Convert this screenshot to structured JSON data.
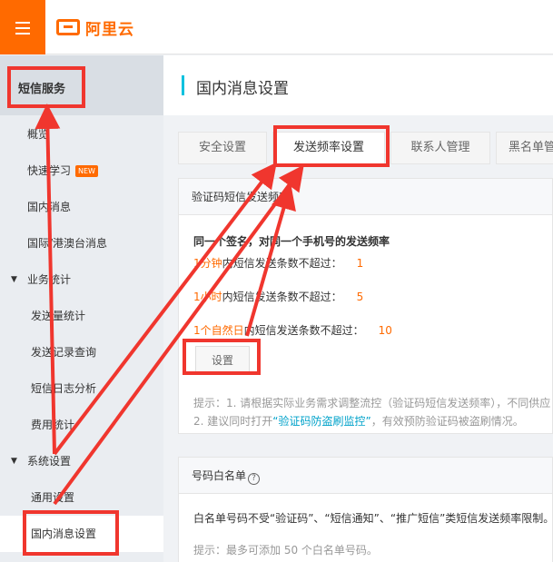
{
  "brand": {
    "name": "阿里云"
  },
  "sidebar": {
    "header": "短信服务",
    "items": [
      {
        "label": "概览"
      },
      {
        "label": "快速学习",
        "badge": "NEW"
      },
      {
        "label": "国内消息"
      },
      {
        "label": "国际/港澳台消息"
      },
      {
        "label": "业务统计"
      },
      {
        "label": "发送量统计"
      },
      {
        "label": "发送记录查询"
      },
      {
        "label": "短信日志分析"
      },
      {
        "label": "费用统计"
      },
      {
        "label": "系统设置"
      },
      {
        "label": "通用设置"
      },
      {
        "label": "国内消息设置"
      }
    ]
  },
  "page": {
    "title": "国内消息设置"
  },
  "tabs": [
    {
      "label": "安全设置"
    },
    {
      "label": "发送频率设置"
    },
    {
      "label": "联系人管理"
    },
    {
      "label": "黑名单管"
    }
  ],
  "frequency_panel": {
    "title": "验证码短信发送频率",
    "subtitle": "同一个签名，对同一个手机号的发送频率",
    "rows": [
      {
        "period": "1分钟",
        "text": "内短信发送条数不超过：",
        "value": "1"
      },
      {
        "period": "1小时",
        "text": "内短信发送条数不超过：",
        "value": "5"
      },
      {
        "period": "1个自然日",
        "text": "内短信发送条数不超过：",
        "value": "10"
      }
    ],
    "button": "设置",
    "hint1": "提示：1. 请根据实际业务需求调整流控（验证码短信发送频率），不同供应",
    "hint2_pre": "2. 建议同时打开",
    "hint2_link": "“验证码防盗刷监控”",
    "hint2_post": "，有效预防验证码被盗刷情况。"
  },
  "whitelist_panel": {
    "title": "号码白名单",
    "desc": "白名单号码不受“验证码”、“短信通知”、“推广短信”类短信发送频率限制。您",
    "hint": "提示：最多可添加 50 个白名单号码。"
  },
  "colors": {
    "brand": "#ff6a00",
    "accent": "#00c1de",
    "annotation": "#f0362e",
    "link": "#00a2ca"
  }
}
